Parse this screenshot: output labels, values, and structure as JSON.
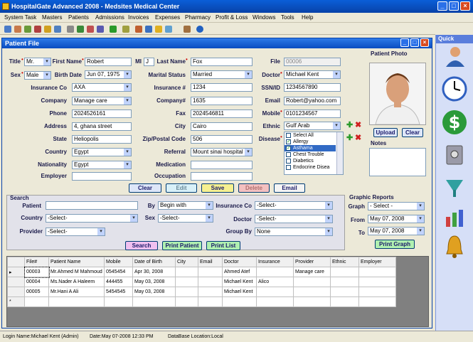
{
  "app": {
    "title": "HospitalGate Advanced 2008 - Medsites Medical Center"
  },
  "menu": [
    "System Task",
    "Masters",
    "Patients",
    "Admissions",
    "Invoices",
    "Expenses",
    "Pharmacy",
    "Profit & Loss",
    "Windows",
    "Tools",
    "Help"
  ],
  "quick": {
    "title": "Quick"
  },
  "window": {
    "title": "Patient File"
  },
  "form": {
    "title_label": "Title",
    "title_value": "Mr.",
    "first_name_label": "First Name",
    "first_name": "Robert",
    "mi_label": "MI",
    "mi": "J",
    "last_name_label": "Last Name",
    "last_name": "Fox",
    "file_label": "File",
    "file": "00006",
    "sex_label": "Sex",
    "sex": "Male",
    "birth_date_label": "Birth Date",
    "birth_date": "Jun 07, 1975",
    "marital_label": "Marital Status",
    "marital": "Married",
    "doctor_label": "Doctor",
    "doctor": "Michael Kent",
    "insurance_co_label": "Insurance Co",
    "insurance_co": "AXA",
    "insurance_no_label": "Insurance #",
    "insurance_no": "1234",
    "ssn_label": "SSN/ID",
    "ssn": "1234567890",
    "company_label": "Company",
    "company": "Manage care",
    "company_no_label": "Company#",
    "company_no": "1635",
    "email_label": "Email",
    "email": "Robert@yahoo.com",
    "phone_label": "Phone",
    "phone": "2024526161",
    "fax_label": "Fax",
    "fax": "2024546811",
    "mobile_label": "Mobile",
    "mobile": "0101234567",
    "address_label": "Address",
    "address": "4, ghana street",
    "city_label": "City",
    "city": "Cairo",
    "ethnic_label": "Ethnic",
    "ethnic": "Gulf Arab",
    "state_label": "State",
    "state": "Heliopolis",
    "zip_label": "Zip/Postal Code",
    "zip": "506",
    "disease_label": "Disease",
    "country_label": "Country",
    "country": "Egypt",
    "referral_label": "Referral",
    "referral": "Mount sinai hospital",
    "nationality_label": "Nationality",
    "nationality": "Egypt",
    "medication_label": "Medication",
    "medication": "",
    "employer_label": "Employer",
    "employer": "",
    "occupation_label": "Occupation",
    "occupation": ""
  },
  "diseases": [
    {
      "label": "Select All",
      "checked": false
    },
    {
      "label": "Allergy",
      "checked": true
    },
    {
      "label": "Asthama",
      "checked": true
    },
    {
      "label": "Chest Trouble",
      "checked": false
    },
    {
      "label": "Diabetics",
      "checked": false
    },
    {
      "label": "Endocrine Disea",
      "checked": false
    }
  ],
  "photo": {
    "title": "Patient Photo",
    "upload": "Upload",
    "clear": "Clear",
    "notes": "Notes"
  },
  "actions": {
    "clear": "Clear",
    "edit": "Edit",
    "save": "Save",
    "delete": "Delete",
    "email": "Email"
  },
  "search": {
    "title": "Search",
    "patient_label": "Patient",
    "patient": "",
    "by_label": "By",
    "by": "Begin with",
    "insco_label": "Insurance Co",
    "insco": "-Select-",
    "country_label": "Country",
    "country": "-Select-",
    "sex_label": "Sex",
    "sex": "-Select-",
    "doctor_label": "Doctor",
    "doctor": "-Select-",
    "provider_label": "Provider",
    "provider": "-Select-",
    "group_label": "Group By",
    "group": "None",
    "search_btn": "Search",
    "print_patient": "Print Patient",
    "print_list": "Print List"
  },
  "reports": {
    "title": "Graphic Reports",
    "graph_label": "Graph",
    "graph": "- Select -",
    "from_label": "From",
    "from": "May 07, 2008",
    "to_label": "To",
    "to": "May 07, 2008",
    "print_graph": "Print Graph"
  },
  "grid": {
    "columns": [
      "File#",
      "Patient Name",
      "Mobile",
      "Date of Birth",
      "City",
      "Email",
      "Doctor",
      "Insurance",
      "Provider",
      "Ethnic",
      "Employer"
    ],
    "rows": [
      [
        "00003",
        "Mr.Ahmed M Mahmoud",
        "0545454",
        "Apr 30, 2008",
        "",
        "",
        "Ahmed Atef",
        "",
        "Manage care",
        "",
        ""
      ],
      [
        "00004",
        "Ms.Nader A Haleem",
        "444455",
        "May 03, 2008",
        "",
        "",
        "Michael Kent",
        "Alico",
        "",
        "",
        ""
      ],
      [
        "00005",
        "Mr.Hani A Ali",
        "5454545",
        "May 03, 2008",
        "",
        "",
        "Michael Kent",
        "",
        "",
        "",
        ""
      ]
    ],
    "new_row_marker": "*"
  },
  "status": {
    "login": "Login Name:Michael Kent (Admin)",
    "date": "Date:May 07-2008   12:33  PM",
    "db": "DataBase Location:Local"
  }
}
